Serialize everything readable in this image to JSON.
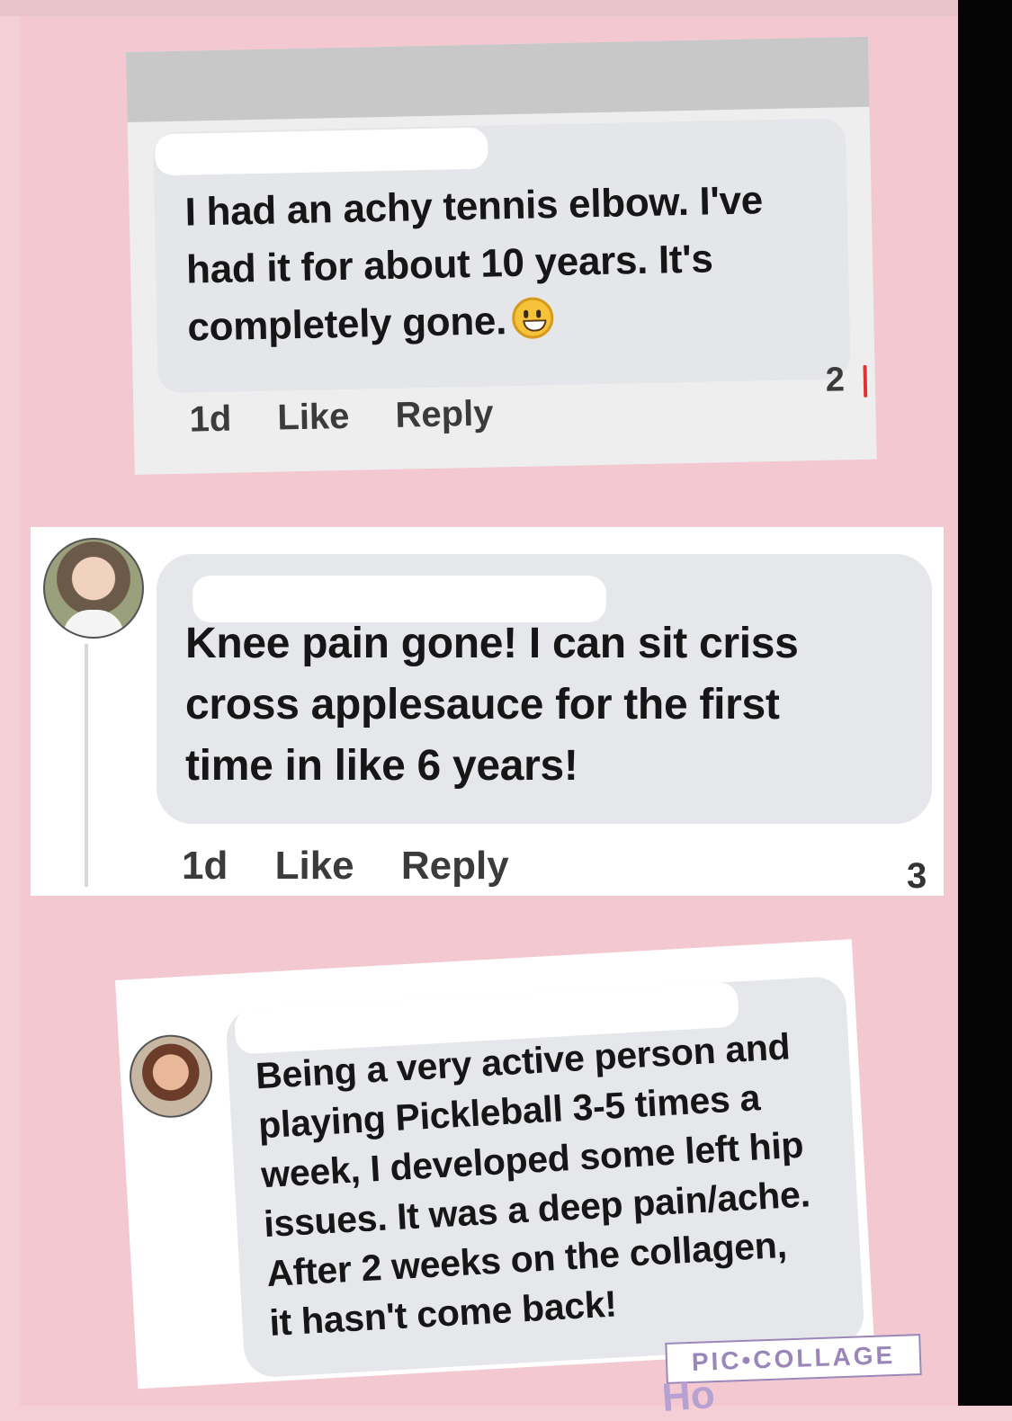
{
  "comments": [
    {
      "text_lines": [
        "I had an achy tennis elbow. I've",
        "had it for about 10 years. It's",
        "completely gone."
      ],
      "emoji": "grinning-face-icon",
      "time": "1d",
      "like_label": "Like",
      "reply_label": "Reply",
      "reaction_count": "2"
    },
    {
      "text_lines": [
        "Knee pain gone! I can sit criss",
        "cross applesauce for the first",
        "time in like 6 years!"
      ],
      "time": "1d",
      "like_label": "Like",
      "reply_label": "Reply",
      "reaction_count": "3"
    },
    {
      "text_lines": [
        "Being a very active person and",
        "playing Pickleball 3-5 times a",
        "week, I developed some left hip",
        "issues. It was a deep pain/ache.",
        "After 2 weeks on the collagen,",
        "it hasn't come back!"
      ]
    }
  ],
  "watermark": "PIC•COLLAGE",
  "watermark_extra": "Ho"
}
